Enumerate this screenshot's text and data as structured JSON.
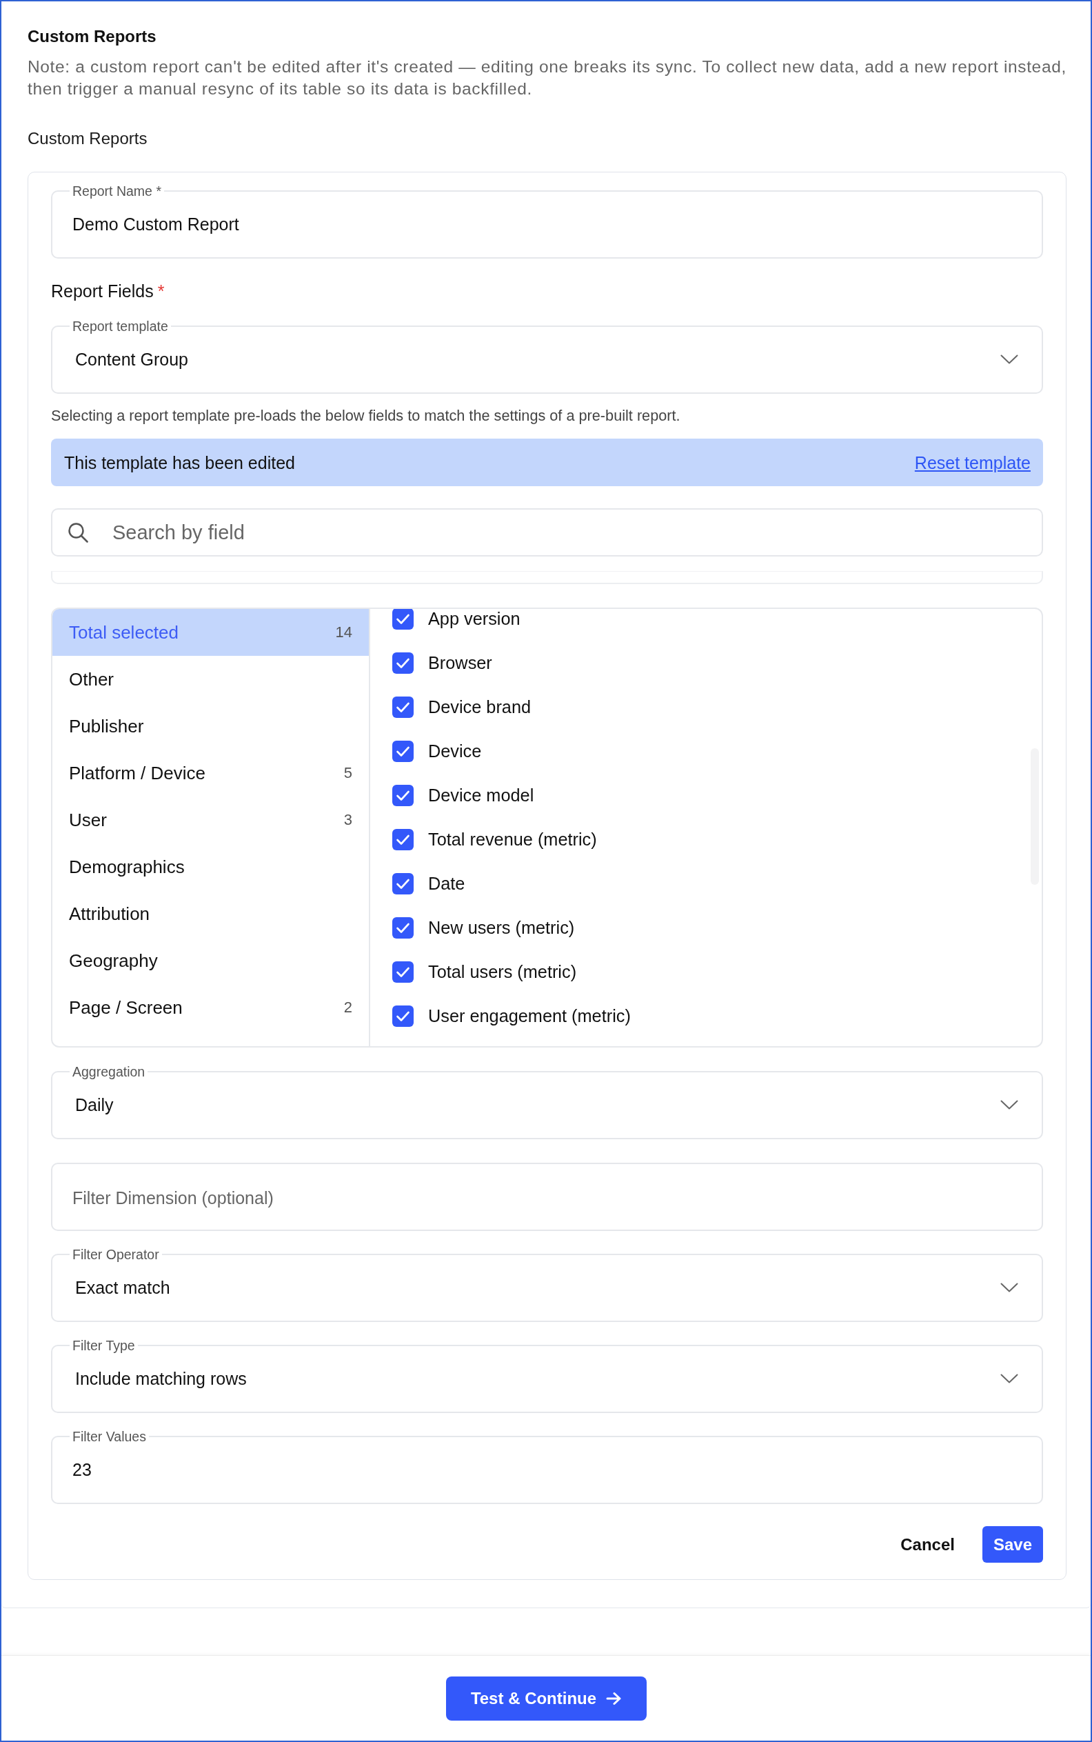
{
  "header": {
    "title": "Custom Reports",
    "note": "Note: a custom report can't be edited after it's created — editing one breaks its sync. To collect new data, add a new report instead, then trigger a manual resync of its table so its data is backfilled."
  },
  "section": {
    "heading": "Custom Reports"
  },
  "report_name": {
    "label": "Report Name *",
    "value": "Demo Custom Report"
  },
  "report_fields": {
    "heading": "Report Fields",
    "required_mark": "*",
    "template": {
      "label": "Report template",
      "value": "Content Group",
      "hint": "Selecting a report template pre-loads the below fields to match the settings of a pre-built report."
    },
    "banner": {
      "text": "This template has been edited",
      "link": "Reset template"
    },
    "search": {
      "placeholder": "Search by field"
    },
    "categories": [
      {
        "label": "Total selected",
        "count": "14",
        "selected": true
      },
      {
        "label": "Other",
        "selected": false
      },
      {
        "label": "Publisher",
        "selected": false
      },
      {
        "label": "Platform / Device",
        "count": "5",
        "selected": false
      },
      {
        "label": "User",
        "count": "3",
        "selected": false
      },
      {
        "label": "Demographics",
        "selected": false
      },
      {
        "label": "Attribution",
        "selected": false
      },
      {
        "label": "Geography",
        "selected": false
      },
      {
        "label": "Page / Screen",
        "count": "2",
        "selected": false
      }
    ],
    "fields": [
      {
        "label": "App version",
        "checked": true
      },
      {
        "label": "Browser",
        "checked": true
      },
      {
        "label": "Device brand",
        "checked": true
      },
      {
        "label": "Device",
        "checked": true
      },
      {
        "label": "Device model",
        "checked": true
      },
      {
        "label": "Total revenue (metric)",
        "checked": true
      },
      {
        "label": "Date",
        "checked": true
      },
      {
        "label": "New users (metric)",
        "checked": true
      },
      {
        "label": "Total users (metric)",
        "checked": true
      },
      {
        "label": "User engagement (metric)",
        "checked": true
      }
    ]
  },
  "settings": [
    {
      "kind": "select",
      "label": "Aggregation",
      "value": "Daily"
    },
    {
      "kind": "input",
      "placeholder": "Filter Dimension (optional)"
    },
    {
      "kind": "select",
      "label": "Filter Operator",
      "value": "Exact match"
    },
    {
      "kind": "select",
      "label": "Filter Type",
      "value": "Include matching rows"
    },
    {
      "kind": "input",
      "label": "Filter Values",
      "value": "23"
    }
  ],
  "actions": {
    "cancel": "Cancel",
    "save": "Save"
  },
  "footer": {
    "button": "Test & Continue"
  }
}
